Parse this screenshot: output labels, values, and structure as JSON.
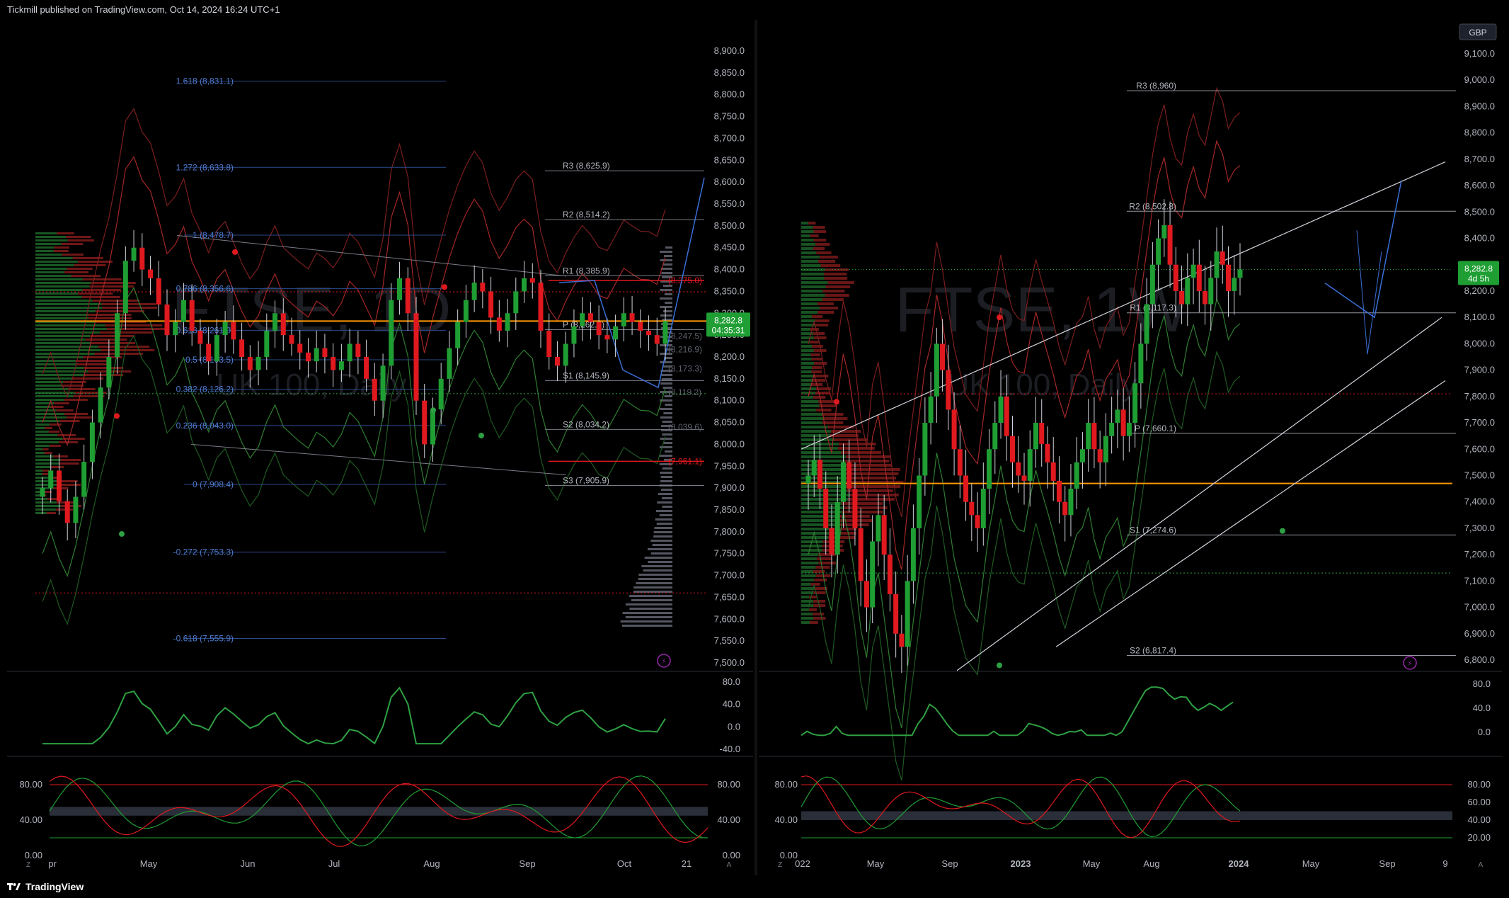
{
  "header": {
    "publisher_text": "Tickmill published on TradingView.com, Oct 14, 2024 16:24 UTC+1"
  },
  "footer": {
    "brand": "TradingView",
    "brand_icon": "tradingview-logo-icon"
  },
  "colors": {
    "bull": "#1f9e33",
    "bear": "#e0191f",
    "orange": "#ff9800",
    "blue": "#3a6fd8",
    "grid": "#2a2e39"
  },
  "left_chart": {
    "watermark_symbol": "FTSE, 1D",
    "watermark_name": "UK 100, Daily",
    "price_ticks": [
      "8,900.0",
      "8,850.0",
      "8,800.0",
      "8,750.0",
      "8,700.0",
      "8,650.0",
      "8,600.0",
      "8,550.0",
      "8,500.0",
      "8,450.0",
      "8,400.0",
      "8,350.0",
      "8,300.0",
      "8,250.0",
      "8,200.0",
      "8,150.0",
      "8,100.0",
      "8,050.0",
      "8,000.0",
      "7,950.0",
      "7,900.0",
      "7,850.0",
      "7,800.0",
      "7,750.0",
      "7,700.0",
      "7,650.0",
      "7,600.0",
      "7,550.0",
      "7,500.0"
    ],
    "time_ticks": [
      "pr",
      "May",
      "Jun",
      "Jul",
      "Aug",
      "Sep",
      "Oct",
      "21"
    ],
    "fib_labels": [
      "1.618 (8,831.1)",
      "1.272 (8,633.8)",
      "1 (8,478.7)",
      "0.786 (8,356.6)",
      "0.618 (8,261.0)",
      "0.5 (8,193.5)",
      "0.382 (8,126.2)",
      "0.236 (8,043.0)",
      "0 (7,908.4)",
      "-0.272 (7,753.3)",
      "-0.618 (7,555.9)"
    ],
    "pivot_labels": [
      "R3 (8,625.9)",
      "R2 (8,514.2)",
      "R1 (8,385.9)",
      "P (8,262.4)",
      "S1 (8,145.9)",
      "S2 (8,034.2)",
      "S3 (7,905.9)"
    ],
    "level_labels": [
      "(8,375.0)",
      "(8,247.5)",
      "(8,216.9)",
      "(8,173.3)",
      "(8,119.2)",
      "(8,039.6)",
      "(7,961.1)"
    ],
    "price_badge": {
      "price": "8,282.8",
      "countdown": "04:35:31"
    },
    "rsi_ticks": [
      "80.0",
      "40.0",
      "0.0",
      "-40.0"
    ],
    "stoch_ticks_left": [
      "80.00",
      "40.00",
      "0.00"
    ],
    "stoch_ticks_right": [
      "80.00",
      "40.00",
      "0.00"
    ],
    "close_series": [
      7900,
      7940,
      7870,
      7820,
      7880,
      7960,
      8050,
      8130,
      8200,
      8300,
      8420,
      8450,
      8400,
      8380,
      8320,
      8250,
      8280,
      8330,
      8260,
      8230,
      8190,
      8250,
      8280,
      8240,
      8200,
      8170,
      8200,
      8260,
      8300,
      8250,
      8230,
      8210,
      8190,
      8220,
      8200,
      8170,
      8190,
      8230,
      8200,
      8150,
      8100,
      8180,
      8330,
      8380,
      8300,
      8100,
      8000,
      8080,
      8150,
      8220,
      8280,
      8330,
      8370,
      8350,
      8290,
      8260,
      8300,
      8350,
      8380,
      8370,
      8260,
      8200,
      8180,
      8230,
      8270,
      8300,
      8280,
      8250,
      8240,
      8270,
      8300,
      8280,
      8260,
      8250,
      8230,
      8282
    ]
  },
  "right_chart": {
    "watermark_symbol": "FTSE, 1W",
    "watermark_name": "UK 100, Daily",
    "currency": "GBP",
    "price_ticks": [
      "9,100.0",
      "9,000.0",
      "8,900.0",
      "8,800.0",
      "8,700.0",
      "8,600.0",
      "8,500.0",
      "8,400.0",
      "8,300.0",
      "8,200.0",
      "8,100.0",
      "8,000.0",
      "7,900.0",
      "7,800.0",
      "7,700.0",
      "7,600.0",
      "7,500.0",
      "7,400.0",
      "7,300.0",
      "7,200.0",
      "7,100.0",
      "7,000.0",
      "6,900.0",
      "6,800.0"
    ],
    "time_ticks": [
      "022",
      "May",
      "Sep",
      "2023",
      "May",
      "Aug",
      "2024",
      "May",
      "Sep",
      "9"
    ],
    "pivot_labels": [
      "R3 (8,960)",
      "R2 (8,502.8)",
      "R1 (8,117.3)",
      "P (7,660.1)",
      "S1 (7,274.6)",
      "S2 (6,817.4)"
    ],
    "price_badge": {
      "price": "8,282.8",
      "countdown": "4d 5h"
    },
    "rsi_ticks": [
      "80.0",
      "40.0",
      "0.0"
    ],
    "stoch_ticks_left": [
      "80.00",
      "40.00",
      "0.00"
    ],
    "stoch_ticks_right": [
      "80.00",
      "60.00",
      "40.00",
      "20.00"
    ],
    "close_series": [
      7500,
      7560,
      7450,
      7300,
      7200,
      7400,
      7550,
      7450,
      7300,
      7100,
      7000,
      7250,
      7350,
      7200,
      7050,
      6900,
      6850,
      7100,
      7300,
      7500,
      7700,
      7800,
      8000,
      7900,
      7750,
      7600,
      7500,
      7400,
      7350,
      7300,
      7450,
      7600,
      7700,
      7800,
      7650,
      7550,
      7500,
      7480,
      7600,
      7700,
      7620,
      7550,
      7480,
      7400,
      7350,
      7450,
      7550,
      7600,
      7700,
      7600,
      7550,
      7650,
      7700,
      7750,
      7650,
      7700,
      7850,
      8000,
      8150,
      8300,
      8400,
      8450,
      8300,
      8200,
      8150,
      8250,
      8300,
      8200,
      8150,
      8250,
      8350,
      8300,
      8200,
      8250,
      8282
    ]
  }
}
